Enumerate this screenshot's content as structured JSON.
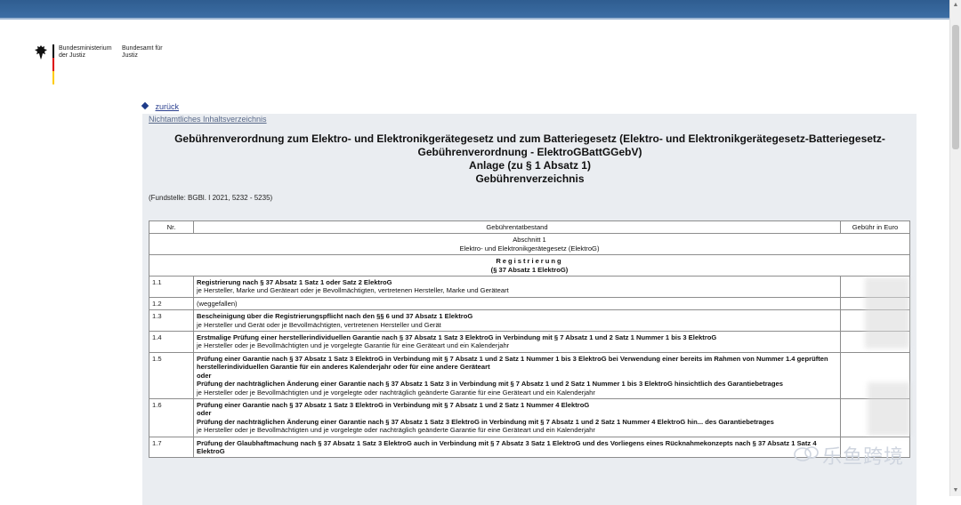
{
  "logo": {
    "ministry": "Bundesministerium der Justiz",
    "office": "Bundesamt für Justiz",
    "colors": {
      "black": "#000000",
      "red": "#dd0000",
      "gold": "#ffcc00"
    }
  },
  "nav": {
    "back_label": "zurück",
    "toc_label": "Nichtamtliches Inhaltsverzeichnis"
  },
  "document": {
    "title_lines": [
      "Gebührenverordnung zum Elektro- und Elektronikgerätegesetz und zum Batteriegesetz (Elektro- und Elektronikgerätegesetz-Batteriegesetz-",
      "Gebührenverordnung - ElektroGBattGGebV)",
      "Anlage (zu § 1 Absatz 1)",
      "Gebührenverzeichnis"
    ],
    "source": "(Fundstelle: BGBl. I 2021, 5232 - 5235)"
  },
  "table": {
    "headers": {
      "nr": "Nr.",
      "tatbestand": "Gebührentatbestand",
      "gebuehr": "Gebühr in Euro"
    },
    "section": {
      "line1": "Abschnitt 1",
      "line2": "Elektro- und Elektronikgerätegesetz (ElektroG)"
    },
    "subsection": {
      "line1": "Registrierung",
      "line2": "(§ 37 Absatz 1 ElektroG)"
    },
    "rows": [
      {
        "nr": "1.1",
        "bold": [
          "Registrierung nach § 37 Absatz 1 Satz 1 oder Satz 2 ElektroG"
        ],
        "normal": "je Hersteller, Marke und Geräteart oder je Bevollmächtigten, vertretenen Hersteller, Marke und Geräteart"
      },
      {
        "nr": "1.2",
        "bold": [],
        "normal": "(weggefallen)"
      },
      {
        "nr": "1.3",
        "bold": [
          "Bescheinigung über die Registrierungspflicht nach den §§ 6 und 37 Absatz 1 ElektroG"
        ],
        "normal": "je Hersteller und Gerät oder je Bevollmächtigten, vertretenen Hersteller und Gerät"
      },
      {
        "nr": "1.4",
        "bold": [
          "Erstmalige Prüfung einer herstellerindividuellen Garantie nach § 37 Absatz 1 Satz 3 ElektroG in Verbindung mit § 7 Absatz 1 und 2 Satz 1 Nummer 1 bis 3 ElektroG"
        ],
        "normal": "je Hersteller oder je Bevollmächtigten und je vorgelegte Garantie für eine Geräteart und ein Kalenderjahr"
      },
      {
        "nr": "1.5",
        "bold": [
          "Prüfung einer Garantie nach § 37 Absatz 1 Satz 3 ElektroG in Verbindung mit § 7 Absatz 1 und 2 Satz 1 Nummer 1 bis 3 ElektroG bei Verwendung einer bereits im Rahmen von Nummer 1.4 geprüften herstellerindividuellen Garantie für ein anderes Kalenderjahr oder für eine andere Geräteart",
          "oder",
          "Prüfung der nachträglichen Änderung einer Garantie nach § 37 Absatz 1 Satz 3 in Verbindung mit § 7 Absatz 1 und 2 Satz 1 Nummer 1 bis 3 ElektroG hinsichtlich des Garantiebetrages"
        ],
        "normal": "je Hersteller oder je Bevollmächtigten und je vorgelegte oder nachträglich geänderte Garantie für eine Geräteart und ein Kalenderjahr"
      },
      {
        "nr": "1.6",
        "bold": [
          "Prüfung einer Garantie nach § 37 Absatz 1 Satz 3 ElektroG in Verbindung mit § 7 Absatz 1 und 2 Satz 1 Nummer 4 ElektroG",
          "oder",
          "Prüfung der nachträglichen Änderung einer Garantie nach § 37 Absatz 1 Satz 3 ElektroG in Verbindung mit § 7 Absatz 1 und 2 Satz 1 Nummer 4 ElektroG hin... des Garantiebetrages"
        ],
        "normal": "je Hersteller oder je Bevollmächtigten und je vorgelegte oder nachträglich geänderte Garantie für eine Geräteart und ein Kalenderjahr"
      },
      {
        "nr": "1.7",
        "bold": [
          "Prüfung der Glaubhaftmachung nach § 37 Absatz 1 Satz 3 ElektroG auch in Verbindung mit § 7 Absatz 3 Satz 1 ElektroG und des Vorliegens eines Rücknahmekonzepts nach § 37 Absatz 1 Satz 4 ElektroG"
        ],
        "normal": ""
      }
    ]
  },
  "watermark": {
    "text": "乐鱼跨境"
  }
}
